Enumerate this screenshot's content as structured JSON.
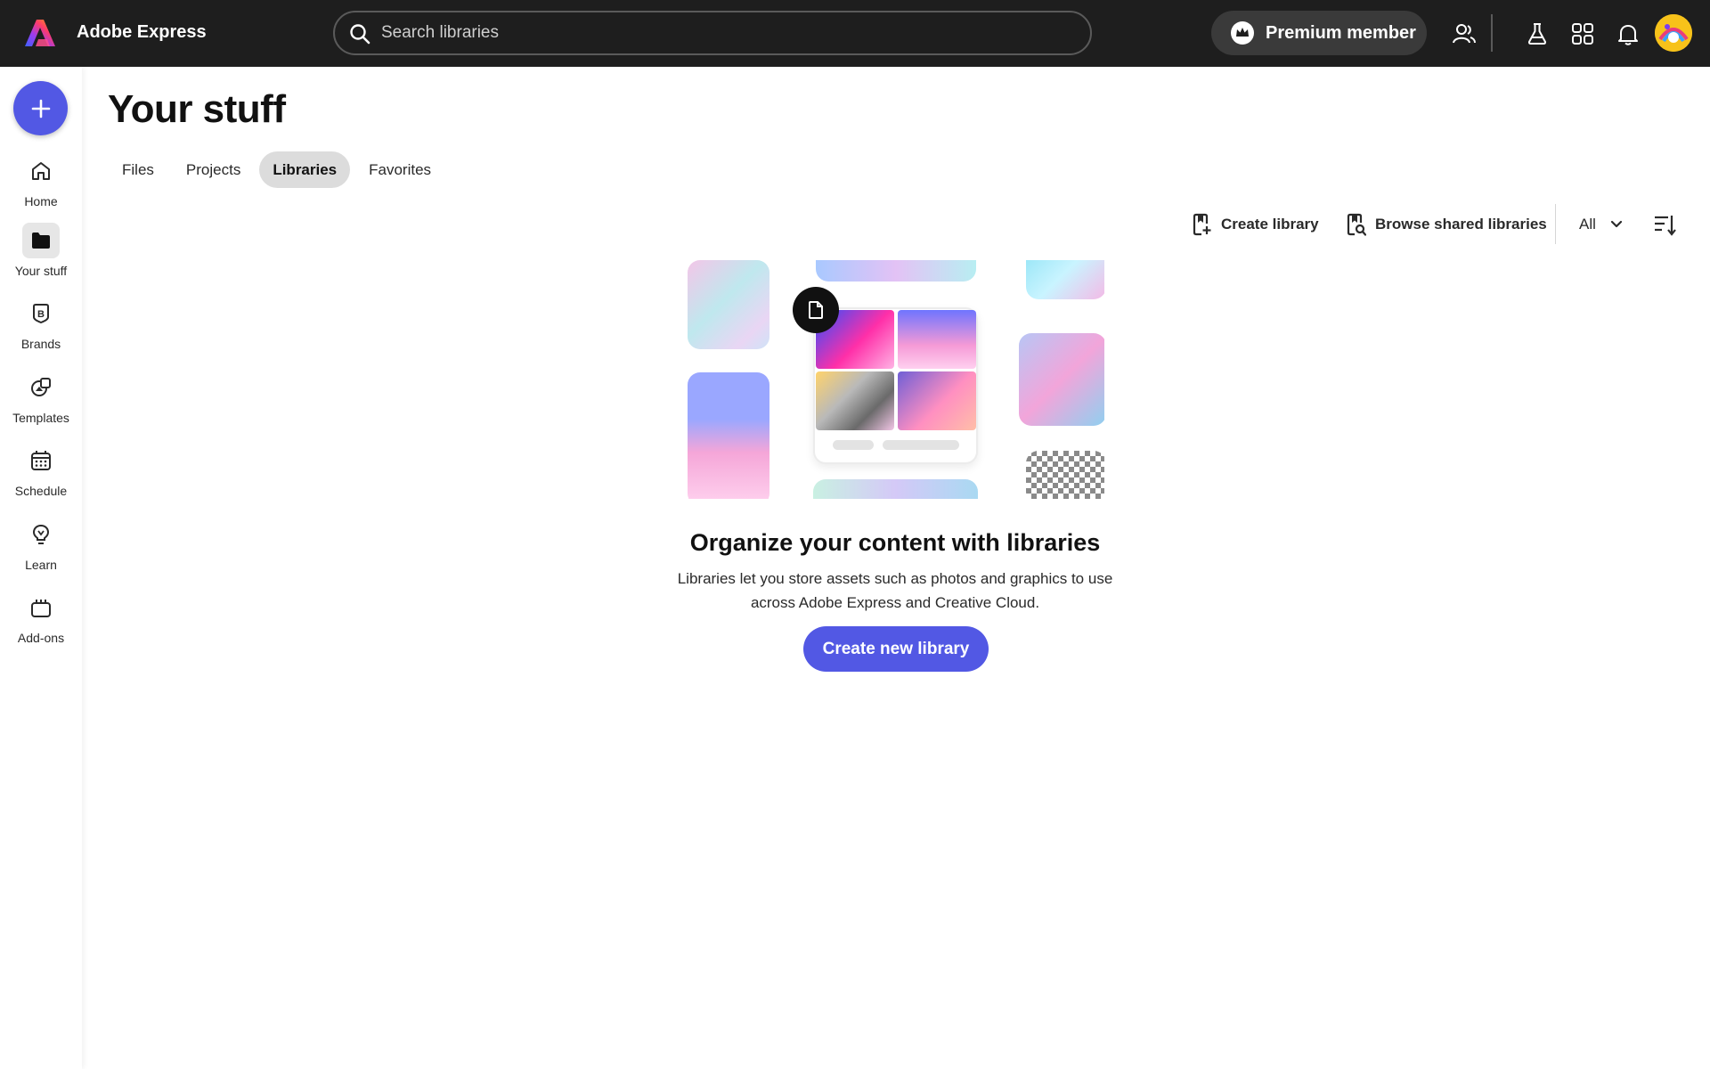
{
  "header": {
    "app_name": "Adobe Express",
    "logo_icon": "adobe-express-logo",
    "search": {
      "placeholder": "Search libraries",
      "value": ""
    },
    "premium_label": "Premium member",
    "icons": [
      "people-icon",
      "flask-icon",
      "apps-grid-icon",
      "bell-icon",
      "avatar"
    ]
  },
  "sidebar": {
    "create_icon": "plus-icon",
    "items": [
      {
        "label": "Home",
        "icon": "home-icon"
      },
      {
        "label": "Your stuff",
        "icon": "folder-icon",
        "active": true
      },
      {
        "label": "Brands",
        "icon": "brand-icon"
      },
      {
        "label": "Templates",
        "icon": "templates-icon"
      },
      {
        "label": "Schedule",
        "icon": "calendar-icon"
      },
      {
        "label": "Learn",
        "icon": "lightbulb-icon"
      },
      {
        "label": "Add-ons",
        "icon": "addons-icon"
      }
    ]
  },
  "main": {
    "title": "Your stuff",
    "tabs": [
      {
        "label": "Files"
      },
      {
        "label": "Projects"
      },
      {
        "label": "Libraries",
        "active": true
      },
      {
        "label": "Favorites"
      }
    ],
    "toolbar": {
      "create_library": "Create library",
      "browse_shared": "Browse shared libraries",
      "filter_value": "All"
    },
    "empty_state": {
      "title": "Organize your content with libraries",
      "description": "Libraries let you store assets such as photos and graphics to use across Adobe Express and Creative Cloud.",
      "cta": "Create new library"
    }
  },
  "colors": {
    "topbar": "#1e1e1e",
    "accent": "#5258e4",
    "active_tab": "#dcdcdc"
  }
}
